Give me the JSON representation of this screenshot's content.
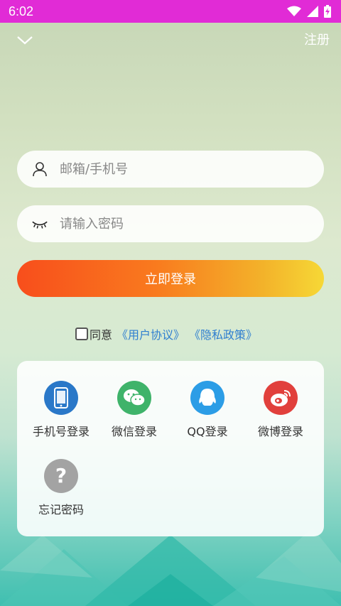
{
  "status_bar": {
    "time": "6:02",
    "background": "#e12bd6",
    "icons": [
      "wifi-icon",
      "signal-icon",
      "battery-icon"
    ]
  },
  "top_bar": {
    "back_icon": "chevron-down-icon",
    "register_label": "注册"
  },
  "form": {
    "account_placeholder": "邮箱/手机号",
    "account_value": "",
    "password_placeholder": "请输入密码",
    "password_value": "",
    "login_button": "立即登录"
  },
  "agreement": {
    "checked": false,
    "agree_text": "同意",
    "user_agreement": "《用户协议》",
    "privacy_policy": "《隐私政策》"
  },
  "login_options": [
    {
      "label": "手机号登录",
      "icon": "phone-icon",
      "color": "#2a78c8"
    },
    {
      "label": "微信登录",
      "icon": "wechat-icon",
      "color": "#3fb36a"
    },
    {
      "label": "QQ登录",
      "icon": "qq-icon",
      "color": "#2c9de6"
    },
    {
      "label": "微博登录",
      "icon": "weibo-icon",
      "color": "#e1403c"
    },
    {
      "label": "忘记密码",
      "icon": "question-icon",
      "color": "#a3a3a3"
    }
  ]
}
